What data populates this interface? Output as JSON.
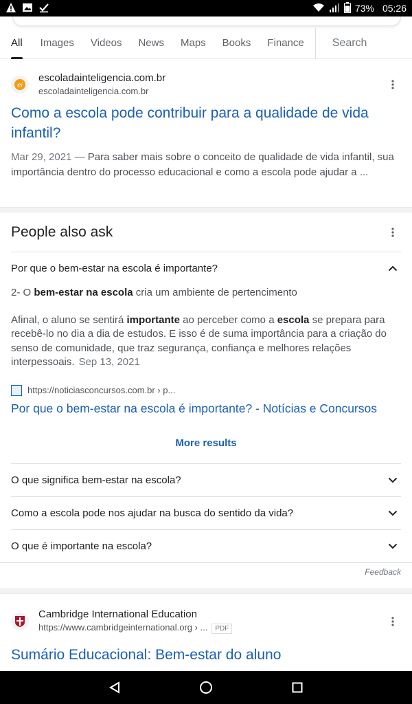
{
  "status_bar": {
    "battery": "73%",
    "time": "05:26"
  },
  "tabs": [
    {
      "label": "All",
      "active": true
    },
    {
      "label": "Images"
    },
    {
      "label": "Videos"
    },
    {
      "label": "News"
    },
    {
      "label": "Maps"
    },
    {
      "label": "Books"
    },
    {
      "label": "Finance"
    },
    {
      "label": "Search"
    }
  ],
  "result1": {
    "site_name": "escoladainteligencia.com.br",
    "site_url": "escoladainteligencia.com.br",
    "title": "Como a escola pode contribuir para a qualidade de vida infantil?",
    "date": "Mar 29, 2021",
    "dash": " — ",
    "snippet": "Para saber mais sobre o conceito de qualidade de vida infantil, sua importância dentro do processo educacional e como a escola pode ajudar a ..."
  },
  "paa": {
    "title": "People also ask",
    "expanded_question": "Por que o bem-estar na escola é importante?",
    "answer_p1_prefix": "2- O ",
    "answer_p1_bold": "bem-estar na escola",
    "answer_p1_suffix": " cria um ambiente de pertencimento",
    "answer_p2_a": "Afinal, o aluno se sentirá ",
    "answer_p2_b": "importante",
    "answer_p2_c": " ao perceber como a ",
    "answer_p2_d": "escola",
    "answer_p2_e": " se prepara para recebê-lo no dia a dia de estudos. E isso é de suma importância para a criação do senso de comunidade, que traz segurança, confiança e melhores relações interpessoais.",
    "answer_date": "Sep 13, 2021",
    "source_url": "https://noticiasconcursos.com.br › p...",
    "source_title": "Por que o bem-estar na escola é importante? - Notícias e Concursos",
    "more_results": "More results",
    "questions": [
      "O que significa bem-estar na escola?",
      "Como a escola pode nos ajudar na busca do sentido da vida?",
      "O que é importante na escola?"
    ],
    "feedback": "Feedback"
  },
  "result2": {
    "site_name": "Cambridge International Education",
    "site_url": "https://www.cambridgeinternational.org › ...",
    "badge": "PDF",
    "title": "Sumário Educacional: Bem-estar do aluno"
  }
}
